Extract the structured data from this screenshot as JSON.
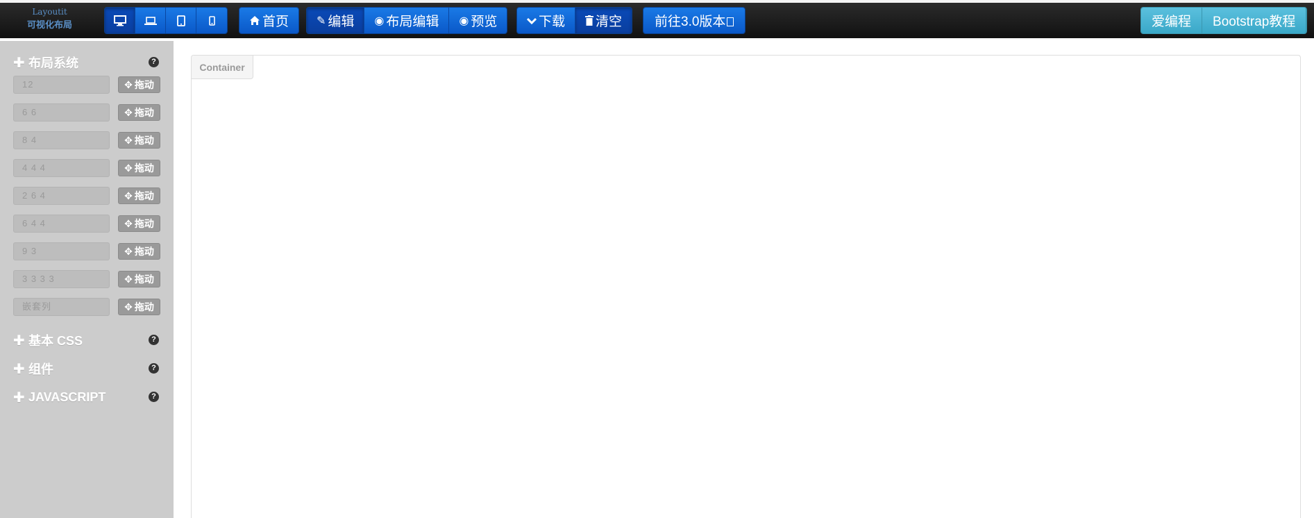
{
  "brand": {
    "line1": "Layoutit",
    "line2": "可视化布局"
  },
  "navbar": {
    "devices": [
      {
        "icon": "desktop-icon",
        "glyph": "🖥"
      },
      {
        "icon": "laptop-icon",
        "glyph": "💻"
      },
      {
        "icon": "tablet-icon",
        "glyph": "▯"
      },
      {
        "icon": "phone-icon",
        "glyph": "▯"
      }
    ],
    "home": {
      "label": "首页",
      "icon": "home-icon"
    },
    "modes": [
      {
        "label": "编辑",
        "icon": "edit-icon"
      },
      {
        "label": "布局编辑",
        "icon": "eye-slash-icon"
      },
      {
        "label": "预览",
        "icon": "eye-icon"
      }
    ],
    "actions": [
      {
        "label": "下载",
        "icon": "chevron-down-icon"
      },
      {
        "label": "清空",
        "icon": "trash-icon"
      }
    ],
    "goto": {
      "label": "前往3.0版本"
    },
    "links": [
      {
        "label": "爱编程"
      },
      {
        "label": "Bootstrap教程"
      }
    ]
  },
  "sidebar": {
    "layout_section": {
      "title": "布局系统",
      "help": "?"
    },
    "rows": [
      {
        "value": "12",
        "drag": "拖动"
      },
      {
        "value": "6 6",
        "drag": "拖动"
      },
      {
        "value": "8 4",
        "drag": "拖动"
      },
      {
        "value": "4 4 4",
        "drag": "拖动"
      },
      {
        "value": "2 6 4",
        "drag": "拖动"
      },
      {
        "value": "6 4 4",
        "drag": "拖动"
      },
      {
        "value": "9 3",
        "drag": "拖动"
      },
      {
        "value": "3 3 3 3",
        "drag": "拖动"
      },
      {
        "value": "嵌套列",
        "drag": "拖动"
      }
    ],
    "sections": [
      {
        "title": "基本 CSS",
        "help": "?"
      },
      {
        "title": "组件",
        "help": "?"
      },
      {
        "title": "JAVASCRIPT",
        "help": "?"
      }
    ]
  },
  "main": {
    "container_label": "Container"
  },
  "colors": {
    "primary": "#0a58c8",
    "info": "#5bc0de",
    "sidebar": "#cccccc"
  }
}
